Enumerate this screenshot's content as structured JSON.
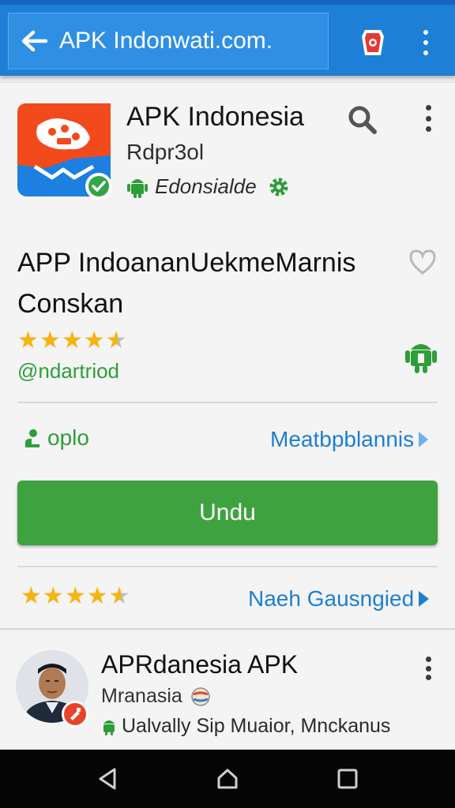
{
  "browser": {
    "url": "APK Indonwati.com.",
    "icons": {
      "back": "arrow-left-icon",
      "app": "app-shortcut-icon",
      "menu": "more-vert-icon"
    }
  },
  "app": {
    "name": "APK Indonesia",
    "developer": "Rdpr3ol",
    "category": "Edonsialde",
    "title": "APP IndoananUekmeMarnis Conskan",
    "rating": 4.5,
    "handle": "@ndartriod",
    "option_label": "oplo",
    "more_link": "Meatbpblannis",
    "download_label": "Undu",
    "review_rating": 4.5,
    "reviews_link": "Naeh Gausngied",
    "colors": {
      "accent": "#1e7fd6",
      "green": "#3ea33f",
      "star": "#f6b311",
      "link": "#1d7fd2"
    }
  },
  "related": {
    "title": "APRdanesia APK",
    "subtitle": "Mranasia",
    "description": "Ualvally Sip Muaior, Mnckanus"
  },
  "navigation": {
    "icons": [
      "back-triangle-icon",
      "home-icon",
      "recents-square-icon"
    ]
  }
}
